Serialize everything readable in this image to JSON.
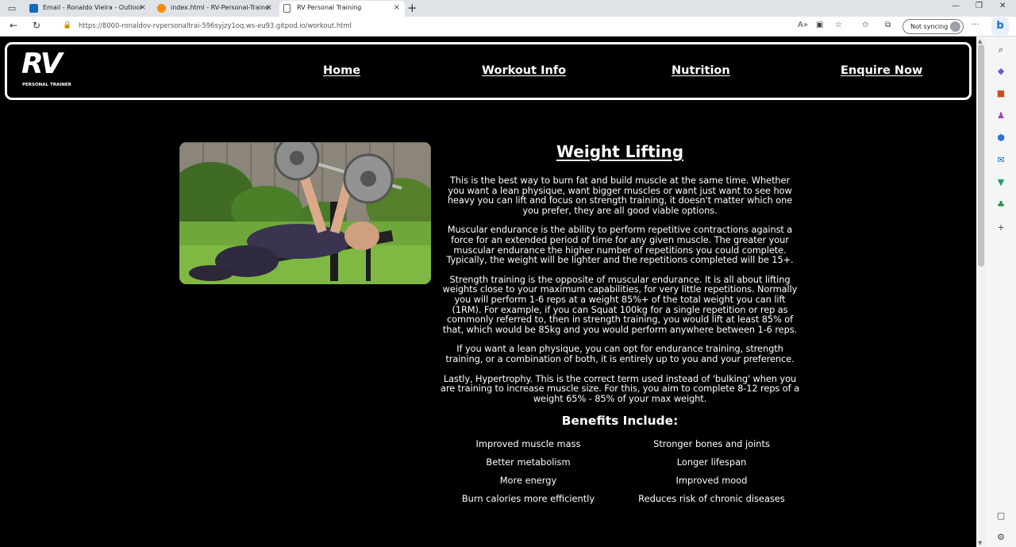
{
  "browser": {
    "tabs": [
      {
        "title": "Email - Ronaldo Vieira - Outlook",
        "favicon": "outlook-icon",
        "active": false
      },
      {
        "title": "index.html - RV-Personal-Trainer",
        "favicon": "gitpod-icon",
        "active": false
      },
      {
        "title": "RV Personal Training",
        "favicon": "page-icon",
        "active": true
      }
    ],
    "new_tab_label": "+",
    "close_glyph": "×",
    "url": "https://8000-ronaldov-rvpersonaltrai-596syjzy1oq.ws-eu93.gitpod.io/workout.html",
    "sync_label": "Not syncing",
    "copilot_glyph": "b"
  },
  "site": {
    "logo": {
      "text": "RV",
      "tagline": "PERSONAL TRAINER"
    },
    "nav": [
      {
        "label": "Home"
      },
      {
        "label": "Workout Info"
      },
      {
        "label": "Nutrition"
      },
      {
        "label": "Enquire Now"
      }
    ]
  },
  "workout": {
    "title": "Weight Lifting",
    "paragraphs": [
      "This is the best way to burn fat and build muscle at the same time. Whether you want a lean physique, want bigger muscles or want just want to see how heavy you can lift and focus on strength training, it doesn't matter which one you prefer, they are all good viable options.",
      "Muscular endurance is the ability to perform repetitive contractions against a force for an extended period of time for any given muscle. The greater your muscular endurance the higher number of repetitions you could complete. Typically, the weight will be lighter and the repetitions completed will be 15+.",
      "Strength training is the opposite of muscular endurance. It is all about lifting weights close to your maximum capabilities, for very little repetitions. Normally you will perform 1-6 reps at a weight 85%+ of the total weight you can lift (1RM). For example, if you can Squat 100kg for a single repetition or rep as commonly referred to, then in strength training, you would lift at least 85% of that, which would be 85kg and you would perform anywhere between 1-6 reps.",
      "If you want a lean physique, you can opt for endurance training, strength training, or a combination of both, it is entirely up to you and your preference.",
      "Lastly, Hypertrophy. This is the correct term used instead of 'bulking' when you are training to increase muscle size. For this, you aim to complete 8-12 reps of a weight 65% - 85% of your max weight."
    ],
    "benefits_heading": "Benefits Include:",
    "benefits": [
      "Improved muscle mass",
      "Stronger bones and joints",
      "Better metabolism",
      "Longer lifespan",
      "More energy",
      "Improved mood",
      "Burn calories more efficiently",
      "Reduces risk of chronic diseases"
    ]
  }
}
